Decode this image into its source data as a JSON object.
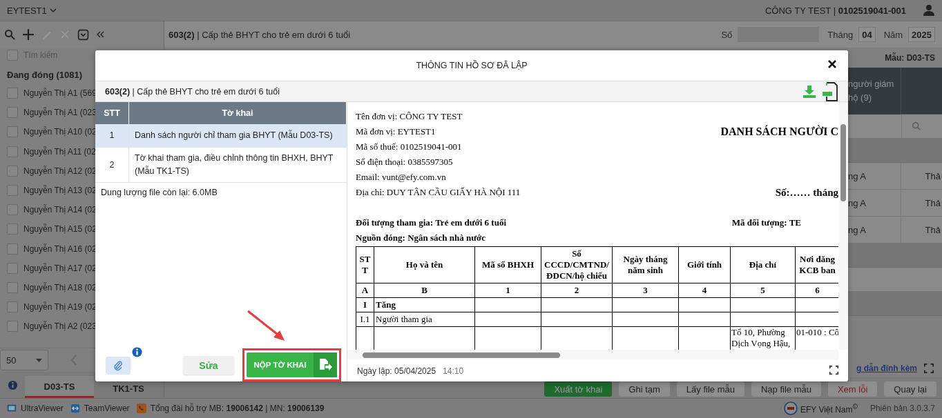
{
  "topbar": {
    "unit": "EYTEST1",
    "company": "CÔNG TY TEST | **0102519041-001**"
  },
  "sidebar": {
    "select_all_checked": false,
    "search_placeholder": "Tìm kiếm",
    "group": "Đang đóng (1081)",
    "items": [
      {
        "label": "Nguyễn Thị A1 (569",
        "checked": false
      },
      {
        "label": "Nguyễn Thị A1 (023",
        "checked": false
      },
      {
        "label": "Nguyễn Thị A10 (02",
        "checked": false
      },
      {
        "label": "Nguyễn Thị A11 (02",
        "checked": false
      },
      {
        "label": "Nguyễn Thị A12 (02",
        "checked": false
      },
      {
        "label": "Nguyễn Thị A13 (02",
        "checked": false
      },
      {
        "label": "Nguyễn Thị A14 (02",
        "checked": false
      },
      {
        "label": "Nguyễn Thị A15 (02",
        "checked": false
      },
      {
        "label": "Nguyễn Thị A16 (02",
        "checked": false
      },
      {
        "label": "Nguyễn Thị A17 (02",
        "checked": false
      },
      {
        "label": "Nguyễn Thị A18 (02",
        "checked": false
      },
      {
        "label": "Nguyễn Thị A19 (02",
        "checked": false
      },
      {
        "label": "Nguyễn Thị A2 (023",
        "checked": false
      }
    ],
    "page_size": "50",
    "tabs": [
      {
        "label": "D03-TS",
        "selected": true
      },
      {
        "label": "TK1-TS",
        "selected": false
      }
    ]
  },
  "header": {
    "title": "**603(2)** | Cấp thẻ BHYT cho trẻ em dưới 6 tuổi",
    "number_label": "Số",
    "month_label": "Tháng",
    "month": "04",
    "year_label": "Năm",
    "year": "2025"
  },
  "form": {
    "template": "Mẫu: D03-TS",
    "table": {
      "columns": [
        "người giám hộ (9)"
      ],
      "rows": [
        {
          "kind": "filter"
        },
        {
          "kind": "group"
        },
        {
          "kind": "data",
          "cells": [
            "ng A",
            "Thả"
          ]
        },
        {
          "kind": "data",
          "cells": [
            "ng A",
            "Thả"
          ]
        },
        {
          "kind": "data",
          "cells": [
            "ng A",
            "Thả"
          ]
        },
        {
          "kind": "group"
        },
        {
          "kind": "empty"
        },
        {
          "kind": "group"
        }
      ]
    },
    "attachment_link": "g dẫn đính kèm",
    "buttons": [
      {
        "label": "Xuất tờ khai",
        "kind": "primary"
      },
      {
        "label": "Ghi tạm",
        "kind": "default"
      },
      {
        "label": "Lấy file mẫu",
        "kind": "default"
      },
      {
        "label": "Nạp file mẫu",
        "kind": "default"
      },
      {
        "label": "Xem lỗi",
        "kind": "danger"
      },
      {
        "label": "Quay lại",
        "kind": "default"
      }
    ]
  },
  "modal": {
    "title": "THÔNG TIN HỒ SƠ ĐÃ LẬP",
    "subtitle": "**603(2)** | Cấp thẻ BHYT cho trẻ em dưới 6 tuổi",
    "forms_table": {
      "columns": [
        "STT",
        "Tờ khai"
      ],
      "rows": [
        {
          "stt": "1",
          "name": "Danh sách người chỉ tham gia BHYT (Mẫu D03-TS)",
          "selected": true
        },
        {
          "stt": "2",
          "name": "Tờ khai tham gia, điều chỉnh thông tin BHXH, BHYT (Mẫu TK1-TS)",
          "selected": false
        }
      ]
    },
    "storage_info": "Dung lượng file còn lại: 6.0MB",
    "edit_button": "Sửa",
    "submit_button": "NỘP TỜ KHAI",
    "document": {
      "info_lines": [
        "Tên đơn vị: CÔNG TY TEST",
        "Mã đơn vị: EYTEST1",
        "Mã số thuế: 0102519041-001",
        "Số điện thoại: 0385597305",
        "Email: vunt@efy.com.vn",
        "Địa chỉ: DUY TÂN CẦU GIẤY HÀ NỘI 111"
      ],
      "title": "DANH SÁCH NGƯỜI C",
      "number_line": "Số:…… tháng",
      "subject": "Đối tượng tham gia: Trẻ em dưới 6 tuổi",
      "subject_code": "Mã đối tượng: TE",
      "source": "Nguồn đóng: Ngân sách nhà nước",
      "table": {
        "columns": [
          "STT",
          "Họ và tên",
          "Mã số BHXH",
          "Số CCCD/CMTND/ ĐDCN/hộ chiếu",
          "Ngày tháng năm sinh",
          "Giới tính",
          "Địa chỉ",
          "Nơi đăng KCB ban"
        ],
        "index_row": [
          "A",
          "B",
          "1",
          "2",
          "3",
          "4",
          "5",
          "6"
        ],
        "rows": [
          {
            "kind": "section",
            "number": "I",
            "label": "Tăng"
          },
          {
            "kind": "group",
            "number": "I.1",
            "label": "Người tham gia"
          },
          {
            "kind": "person",
            "address": "Tổ 10, Phường Dịch Vọng Hậu,",
            "kcb": "01-010 : Cô"
          }
        ]
      }
    },
    "created_label": "Ngày lập: 05/04/2025",
    "created_time": "14:10"
  },
  "status_bar": {
    "apps": [
      {
        "kind": "ultraviewer",
        "label": "UltraViewer"
      },
      {
        "kind": "teamviewer",
        "label": "TeamViewer"
      }
    ],
    "hotline": "Tổng đài hỗ trợ MB: **19006142** | MN: **19006139**",
    "brand": "EFY Việt Nam$^{©}$",
    "version": "Phiên bản 3.0.3.7"
  }
}
